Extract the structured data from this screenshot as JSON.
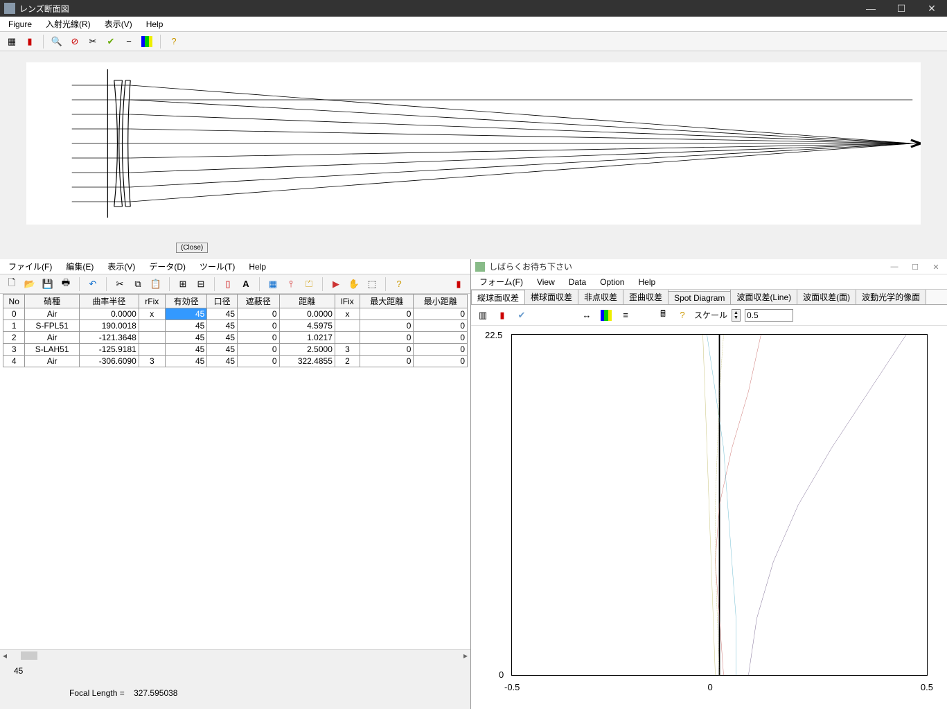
{
  "main_title": "レンズ断面図",
  "main_menu": [
    "Figure",
    "入射光線(R)",
    "表示(V)",
    "Help"
  ],
  "top_button": "(Close)",
  "left_menu": [
    "ファイル(F)",
    "編集(E)",
    "表示(V)",
    "データ(D)",
    "ツール(T)",
    "Help"
  ],
  "table": {
    "headers": [
      "No",
      "硝種",
      "曲率半径",
      "rFix",
      "有効径",
      "口径",
      "遮蔽径",
      "距離",
      "lFix",
      "最大距離",
      "最小距離"
    ],
    "rows": [
      {
        "no": "0",
        "glass": "Air",
        "r": "0.0000",
        "rfix": "x",
        "eff": "45",
        "ap": "45",
        "obs": "0",
        "dist": "0.0000",
        "lfix": "x",
        "max": "0",
        "min": "0",
        "sel": true
      },
      {
        "no": "1",
        "glass": "S-FPL51",
        "r": "190.0018",
        "rfix": "",
        "eff": "45",
        "ap": "45",
        "obs": "0",
        "dist": "4.5975",
        "lfix": "",
        "max": "0",
        "min": "0"
      },
      {
        "no": "2",
        "glass": "Air",
        "r": "-121.3648",
        "rfix": "",
        "eff": "45",
        "ap": "45",
        "obs": "0",
        "dist": "1.0217",
        "lfix": "",
        "max": "0",
        "min": "0"
      },
      {
        "no": "3",
        "glass": "S-LAH51",
        "r": "-125.9181",
        "rfix": "",
        "eff": "45",
        "ap": "45",
        "obs": "0",
        "dist": "2.5000",
        "lfix": "3",
        "max": "0",
        "min": "0"
      },
      {
        "no": "4",
        "glass": "Air",
        "r": "-306.6090",
        "rfix": "3",
        "eff": "45",
        "ap": "45",
        "obs": "0",
        "dist": "322.4855",
        "lfix": "2",
        "max": "0",
        "min": "0"
      }
    ]
  },
  "footer_value": "45",
  "footer_label": "Focal Length =",
  "footer_focal": "327.595038",
  "right_title": "しばらくお待ち下さい",
  "right_menu": [
    "フォーム(F)",
    "View",
    "Data",
    "Option",
    "Help"
  ],
  "tabs": [
    "縦球面収差",
    "横球面収差",
    "非点収差",
    "歪曲収差",
    "Spot Diagram",
    "波面収差(Line)",
    "波面収差(面)",
    "波動光学的像面"
  ],
  "active_tab": 0,
  "scale_label": "スケール",
  "scale_value": "0.5",
  "chart_data": {
    "type": "line",
    "xlabel": "",
    "ylabel": "",
    "xlim": [
      -0.5,
      0.5
    ],
    "ylim": [
      0,
      22.5
    ],
    "x_ticks": [
      "-0.5",
      "0",
      "0.5"
    ],
    "y_ticks": [
      "0",
      "22.5"
    ],
    "series": [
      {
        "name": "red",
        "color": "#c0504d",
        "x": [
          0.01,
          0.0,
          -0.01,
          0.0,
          0.03,
          0.07,
          0.1
        ],
        "y": [
          0,
          3.75,
          7.5,
          11.25,
          15,
          18.75,
          22.5
        ]
      },
      {
        "name": "cyan",
        "color": "#4bacc6",
        "x": [
          0.04,
          0.04,
          0.03,
          0.02,
          0.01,
          -0.01,
          -0.03
        ],
        "y": [
          0,
          3.75,
          7.5,
          11.25,
          15,
          18.75,
          22.5
        ]
      },
      {
        "name": "purple",
        "color": "#604a7b",
        "x": [
          0.07,
          0.09,
          0.13,
          0.19,
          0.27,
          0.36,
          0.45
        ],
        "y": [
          0,
          3.75,
          7.5,
          11.25,
          15,
          18.75,
          22.5
        ]
      },
      {
        "name": "olive",
        "color": "#b9b255",
        "x": [
          -0.01,
          -0.015,
          -0.02,
          -0.025,
          -0.03,
          -0.035,
          -0.04
        ],
        "y": [
          0,
          3.75,
          7.5,
          11.25,
          15,
          18.75,
          22.5
        ]
      },
      {
        "name": "olive-dash",
        "color": "#b9b255",
        "dash": true,
        "x": [
          0.0,
          -0.005,
          -0.01,
          -0.01,
          -0.005,
          0.0,
          0.01
        ],
        "y": [
          0,
          3.75,
          7.5,
          11.25,
          15,
          18.75,
          22.5
        ]
      },
      {
        "name": "black",
        "color": "#000",
        "x": [
          0,
          0,
          0,
          0,
          0,
          0,
          0
        ],
        "y": [
          0,
          3.75,
          7.5,
          11.25,
          15,
          18.75,
          22.5
        ]
      }
    ]
  }
}
